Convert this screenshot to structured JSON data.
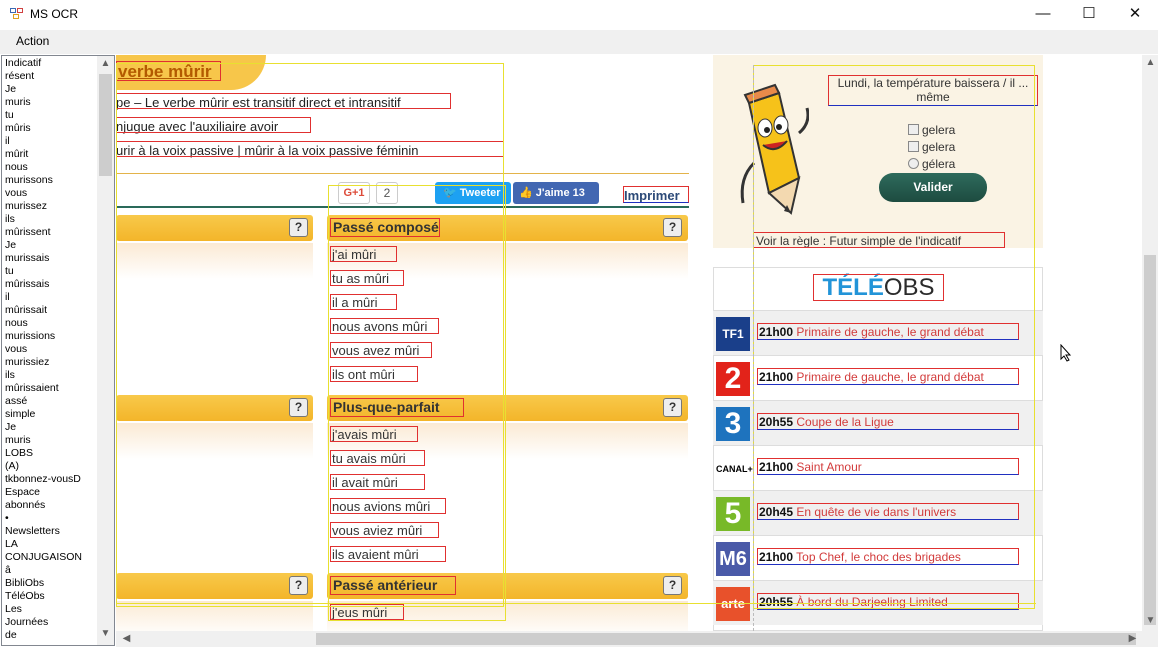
{
  "window": {
    "title": "MS OCR",
    "minimize": "—",
    "maximize": "☐",
    "close": "✕"
  },
  "menu": {
    "action": "Action"
  },
  "list_items": [
    "Indicatif",
    "résent",
    "Je",
    "muris",
    "tu",
    "mûris",
    "il",
    "mûrit",
    "nous",
    "murissons",
    "vous",
    "murissez",
    "ils",
    "mûrissent",
    "Je",
    "murissais",
    "tu",
    "mûrissais",
    "il",
    "mûrissait",
    "nous",
    "murissions",
    "vous",
    "murissiez",
    "ils",
    "mûrissaient",
    "assé",
    "simple",
    "Je",
    "muris",
    "LOBS",
    "(A)",
    "tkbonnez-vousD",
    "Espace",
    "abonnés",
    "•",
    "Newsletters",
    "LA",
    "CONJUGAISON",
    "â",
    "BibliObs",
    "TéléObs",
    "Les",
    "Journées",
    "de"
  ],
  "page": {
    "verbe_title": "verbe mûrir",
    "intro": [
      "pe – Le verbe mûrir est transitif direct et intransitif",
      "njugue avec l'auxiliaire avoir",
      "urir à la voix passive | mûrir à la voix passive féminin"
    ],
    "social": {
      "gplus": "G+1",
      "gcount": "2",
      "tweet": "Tweeter",
      "like": "J'aime 13",
      "imprimer": "Imprimer"
    },
    "tenses": [
      {
        "title": "Passé composé",
        "forms": [
          "j'ai mûri",
          "tu as mûri",
          "il a mûri",
          "nous avons mûri",
          "vous avez mûri",
          "ils ont mûri"
        ]
      },
      {
        "title": "Plus-que-parfait",
        "forms": [
          "j'avais mûri",
          "tu avais mûri",
          "il avait mûri",
          "nous avions mûri",
          "vous aviez mûri",
          "ils avaient mûri"
        ]
      },
      {
        "title": "Passé antérieur",
        "forms": [
          "j'eus mûri"
        ]
      }
    ],
    "qmark": "?",
    "quiz": {
      "question": "Lundi, la température baissera / il ... même",
      "options": [
        "gelera",
        "gelera",
        "gélera"
      ],
      "submit": "Valider",
      "link": "Voir la règle : Futur simple de l'indicatif"
    },
    "teleobs": {
      "tele": "TÉLÉ",
      "obs": "OBS"
    },
    "tv": [
      {
        "channel": "TF1",
        "time": "21h00",
        "program": "Primaire de gauche, le grand débat"
      },
      {
        "channel": "2",
        "time": "21h00",
        "program": "Primaire de gauche, le grand débat"
      },
      {
        "channel": "3",
        "time": "20h55",
        "program": "Coupe de la Ligue"
      },
      {
        "channel": "CANAL+",
        "time": "21h00",
        "program": "Saint Amour"
      },
      {
        "channel": "5",
        "time": "20h45",
        "program": "En quête de vie dans l'univers"
      },
      {
        "channel": "M6",
        "time": "21h00",
        "program": "Top Chef, le choc des brigades"
      },
      {
        "channel": "arte",
        "time": "20h55",
        "program": "À bord du Darjeeling Limited"
      }
    ]
  }
}
